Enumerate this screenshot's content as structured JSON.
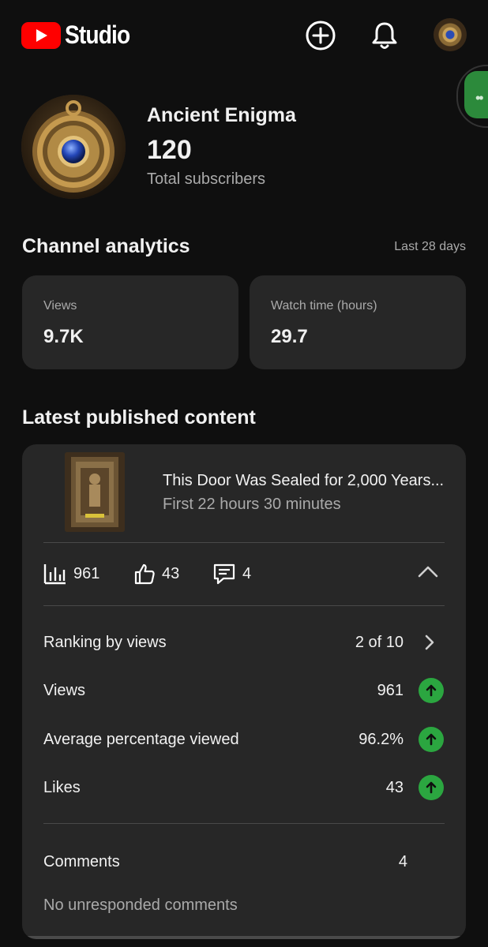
{
  "header": {
    "app_name": "Studio",
    "icons": [
      "create-icon",
      "notifications-icon",
      "account-avatar"
    ]
  },
  "channel": {
    "name": "Ancient Enigma",
    "subscribers": "120",
    "subscribers_label": "Total subscribers"
  },
  "analytics": {
    "title": "Channel analytics",
    "range": "Last 28 days",
    "cards": [
      {
        "label": "Views",
        "value": "9.7K"
      },
      {
        "label": "Watch time (hours)",
        "value": "29.7"
      }
    ]
  },
  "latest": {
    "title": "Latest published content",
    "video_title": "This Door Was Sealed for 2,000 Years...",
    "video_period": "First 22 hours 30 minutes",
    "stats": {
      "views": "961",
      "likes": "43",
      "comments": "4"
    },
    "rows": [
      {
        "label": "Ranking by views",
        "value": "2 of 10"
      },
      {
        "label": "Views",
        "value": "961"
      },
      {
        "label": "Average percentage viewed",
        "value": "96.2%"
      },
      {
        "label": "Likes",
        "value": "43"
      }
    ],
    "comments_row": {
      "label": "Comments",
      "value": "4"
    },
    "comments_note": "No unresponded comments"
  },
  "colors": {
    "background": "#0f0f0f",
    "card": "#272727",
    "brand_red": "#ff0000",
    "up_green": "#2ba640",
    "secondary_text": "#aaaaaa"
  }
}
